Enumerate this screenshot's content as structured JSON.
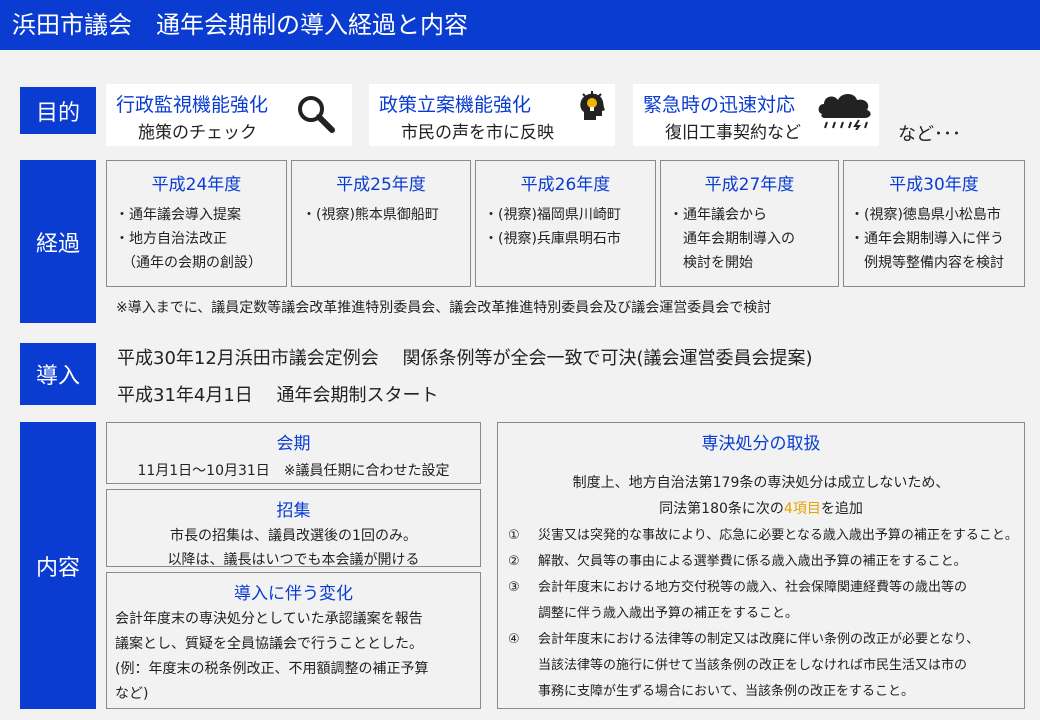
{
  "title": "浜田市議会　通年会期制の導入経過と内容",
  "sections": {
    "purpose": "目的",
    "history": "経過",
    "introduction": "導入",
    "content": "内容"
  },
  "purpose_cards": [
    {
      "title": "行政監視機能強化",
      "sub": "施策のチェック",
      "icon": "magnifier-icon"
    },
    {
      "title": "政策立案機能強化",
      "sub": "市民の声を市に反映",
      "icon": "lightbulb-head-icon"
    },
    {
      "title": "緊急時の迅速対応",
      "sub": "復旧工事契約など",
      "icon": "storm-cloud-icon"
    }
  ],
  "purpose_more": "など･･･",
  "history": {
    "years": [
      {
        "year": "平成24年度",
        "lines": [
          "・通年議会導入提案",
          "・地方自治法改正",
          "　（通年の会期の創設）"
        ]
      },
      {
        "year": "平成25年度",
        "lines": [
          "・(視察)熊本県御船町"
        ]
      },
      {
        "year": "平成26年度",
        "lines": [
          "・(視察)福岡県川崎町",
          "・(視察)兵庫県明石市"
        ]
      },
      {
        "year": "平成27年度",
        "lines": [
          "・通年議会から",
          "　通年会期制導入の",
          "　検討を開始"
        ]
      },
      {
        "year": "平成30年度",
        "lines": [
          "・(視察)徳島県小松島市",
          "・通年会期制導入に伴う",
          "　例規等整備内容を検討"
        ]
      }
    ],
    "note": "※導入までに、議員定数等議会改革推進特別委員会、議会改革推進特別委員会及び議会運営委員会で検討"
  },
  "introduction": {
    "line1": "平成30年12月浜田市議会定例会　 関係条例等が全会一致で可決(議会運営委員会提案)",
    "line2": "平成31年4月1日　 通年会期制スタート"
  },
  "content": {
    "session": {
      "title": "会期",
      "text": "11月1日～10月31日　※議員任期に合わせた設定"
    },
    "convocation": {
      "title": "招集",
      "line1": "市長の招集は、議員改選後の1回のみ。",
      "line2": "以降は、議長はいつでも本会議が開ける"
    },
    "changes": {
      "title": "導入に伴う変化",
      "lines": [
        "会計年度末の専決処分としていた承認議案を報告",
        "議案とし、質疑を全員協議会で行うこととした。",
        "(例：年度末の税条例改正、不用額調整の補正予算",
        "など)"
      ]
    },
    "disposal": {
      "title": "専決処分の取扱",
      "intro1": "制度上、地方自治法第179条の専決処分は成立しないため、",
      "intro2a": "同法第180条に次の",
      "intro2b": "4項目",
      "intro2c": "を追加",
      "items": [
        {
          "num": "①",
          "lines": [
            "災害又は突発的な事故により、応急に必要となる歳入歳出予算の補正をすること。"
          ]
        },
        {
          "num": "②",
          "lines": [
            "解散、欠員等の事由による選挙費に係る歳入歳出予算の補正をすること。"
          ]
        },
        {
          "num": "③",
          "lines": [
            "会計年度末における地方交付税等の歳入、社会保障関連経費等の歳出等の",
            "調整に伴う歳入歳出予算の補正をすること。"
          ]
        },
        {
          "num": "④",
          "lines": [
            "会計年度末における法律等の制定又は改廃に伴い条例の改正が必要となり、",
            "当該法律等の施行に併せて当該条例の改正をしなければ市民生活又は市の",
            "事務に支障が生ずる場合において、当該条例の改正をすること。"
          ]
        }
      ]
    }
  }
}
